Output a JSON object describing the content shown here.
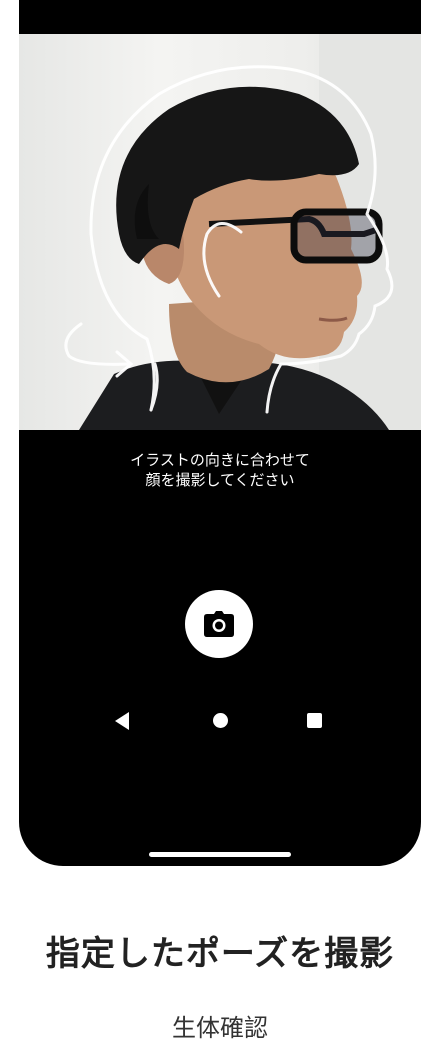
{
  "camera": {
    "instruction_line1": "イラストの向きに合わせて",
    "instruction_line2": "顔を撮影してください",
    "shutter_icon": "camera-icon"
  },
  "nav": {
    "back_icon": "back-triangle-icon",
    "home_icon": "home-circle-icon",
    "recent_icon": "recent-square-icon"
  },
  "caption": {
    "title": "指定したポーズを撮影",
    "subtitle": "生体確認"
  },
  "colors": {
    "screen_background": "#000000",
    "page_background": "#ffffff",
    "guide_outline": "#ffffff"
  }
}
